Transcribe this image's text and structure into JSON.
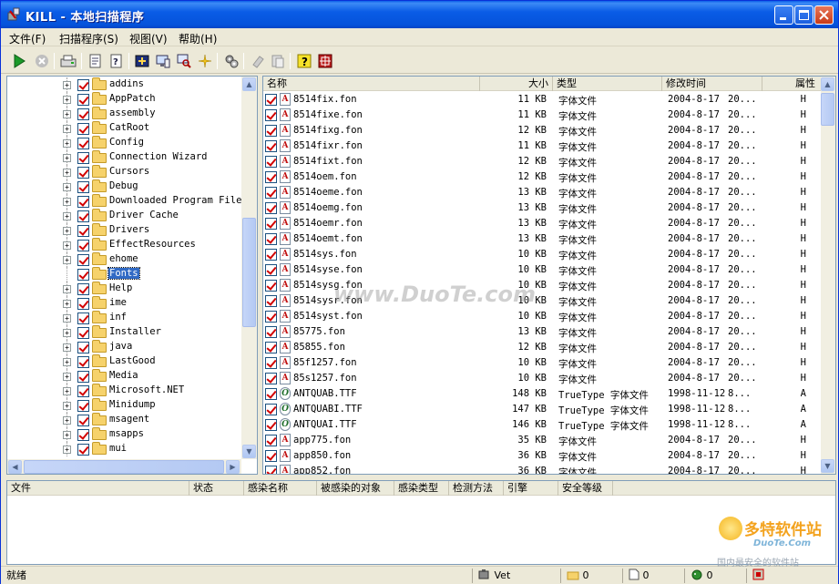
{
  "window": {
    "title": "KILL - 本地扫描程序"
  },
  "menu": [
    "文件(F)",
    "扫描程序(S)",
    "视图(V)",
    "帮助(H)"
  ],
  "tree": {
    "items": [
      {
        "label": "addins",
        "expandable": true
      },
      {
        "label": "AppPatch",
        "expandable": true
      },
      {
        "label": "assembly",
        "expandable": true
      },
      {
        "label": "CatRoot",
        "expandable": true
      },
      {
        "label": "Config",
        "expandable": true
      },
      {
        "label": "Connection Wizard",
        "expandable": true
      },
      {
        "label": "Cursors",
        "expandable": true
      },
      {
        "label": "Debug",
        "expandable": true
      },
      {
        "label": "Downloaded Program Files",
        "expandable": true
      },
      {
        "label": "Driver Cache",
        "expandable": true
      },
      {
        "label": "Drivers",
        "expandable": true
      },
      {
        "label": "EffectResources",
        "expandable": true
      },
      {
        "label": "ehome",
        "expandable": true
      },
      {
        "label": "Fonts",
        "expandable": false,
        "selected": true
      },
      {
        "label": "Help",
        "expandable": true
      },
      {
        "label": "ime",
        "expandable": true
      },
      {
        "label": "inf",
        "expandable": true
      },
      {
        "label": "Installer",
        "expandable": true
      },
      {
        "label": "java",
        "expandable": true
      },
      {
        "label": "LastGood",
        "expandable": true
      },
      {
        "label": "Media",
        "expandable": true
      },
      {
        "label": "Microsoft.NET",
        "expandable": true
      },
      {
        "label": "Minidump",
        "expandable": true
      },
      {
        "label": "msagent",
        "expandable": true
      },
      {
        "label": "msapps",
        "expandable": true
      },
      {
        "label": "mui",
        "expandable": true
      }
    ]
  },
  "list": {
    "columns": [
      "名称",
      "大小",
      "类型",
      "修改时间",
      "属性"
    ],
    "rows": [
      {
        "name": "8514fix.fon",
        "size": "11 KB",
        "type": "字体文件",
        "date": "2004-8-17",
        "time": "20...",
        "attr": "H",
        "icon": "fon"
      },
      {
        "name": "8514fixe.fon",
        "size": "11 KB",
        "type": "字体文件",
        "date": "2004-8-17",
        "time": "20...",
        "attr": "H",
        "icon": "fon"
      },
      {
        "name": "8514fixg.fon",
        "size": "12 KB",
        "type": "字体文件",
        "date": "2004-8-17",
        "time": "20...",
        "attr": "H",
        "icon": "fon"
      },
      {
        "name": "8514fixr.fon",
        "size": "11 KB",
        "type": "字体文件",
        "date": "2004-8-17",
        "time": "20...",
        "attr": "H",
        "icon": "fon"
      },
      {
        "name": "8514fixt.fon",
        "size": "12 KB",
        "type": "字体文件",
        "date": "2004-8-17",
        "time": "20...",
        "attr": "H",
        "icon": "fon"
      },
      {
        "name": "8514oem.fon",
        "size": "12 KB",
        "type": "字体文件",
        "date": "2004-8-17",
        "time": "20...",
        "attr": "H",
        "icon": "fon"
      },
      {
        "name": "8514oeme.fon",
        "size": "13 KB",
        "type": "字体文件",
        "date": "2004-8-17",
        "time": "20...",
        "attr": "H",
        "icon": "fon"
      },
      {
        "name": "8514oemg.fon",
        "size": "13 KB",
        "type": "字体文件",
        "date": "2004-8-17",
        "time": "20...",
        "attr": "H",
        "icon": "fon"
      },
      {
        "name": "8514oemr.fon",
        "size": "13 KB",
        "type": "字体文件",
        "date": "2004-8-17",
        "time": "20...",
        "attr": "H",
        "icon": "fon"
      },
      {
        "name": "8514oemt.fon",
        "size": "13 KB",
        "type": "字体文件",
        "date": "2004-8-17",
        "time": "20...",
        "attr": "H",
        "icon": "fon"
      },
      {
        "name": "8514sys.fon",
        "size": "10 KB",
        "type": "字体文件",
        "date": "2004-8-17",
        "time": "20...",
        "attr": "H",
        "icon": "fon"
      },
      {
        "name": "8514syse.fon",
        "size": "10 KB",
        "type": "字体文件",
        "date": "2004-8-17",
        "time": "20...",
        "attr": "H",
        "icon": "fon"
      },
      {
        "name": "8514sysg.fon",
        "size": "10 KB",
        "type": "字体文件",
        "date": "2004-8-17",
        "time": "20...",
        "attr": "H",
        "icon": "fon"
      },
      {
        "name": "8514sysr.fon",
        "size": "10 KB",
        "type": "字体文件",
        "date": "2004-8-17",
        "time": "20...",
        "attr": "H",
        "icon": "fon"
      },
      {
        "name": "8514syst.fon",
        "size": "10 KB",
        "type": "字体文件",
        "date": "2004-8-17",
        "time": "20...",
        "attr": "H",
        "icon": "fon"
      },
      {
        "name": "85775.fon",
        "size": "13 KB",
        "type": "字体文件",
        "date": "2004-8-17",
        "time": "20...",
        "attr": "H",
        "icon": "fon"
      },
      {
        "name": "85855.fon",
        "size": "12 KB",
        "type": "字体文件",
        "date": "2004-8-17",
        "time": "20...",
        "attr": "H",
        "icon": "fon"
      },
      {
        "name": "85f1257.fon",
        "size": "10 KB",
        "type": "字体文件",
        "date": "2004-8-17",
        "time": "20...",
        "attr": "H",
        "icon": "fon"
      },
      {
        "name": "85s1257.fon",
        "size": "10 KB",
        "type": "字体文件",
        "date": "2004-8-17",
        "time": "20...",
        "attr": "H",
        "icon": "fon"
      },
      {
        "name": "ANTQUAB.TTF",
        "size": "148 KB",
        "type": "TrueType 字体文件",
        "date": "1998-11-12",
        "time": "8...",
        "attr": "A",
        "icon": "ttf"
      },
      {
        "name": "ANTQUABI.TTF",
        "size": "147 KB",
        "type": "TrueType 字体文件",
        "date": "1998-11-12",
        "time": "8...",
        "attr": "A",
        "icon": "ttf"
      },
      {
        "name": "ANTQUAI.TTF",
        "size": "146 KB",
        "type": "TrueType 字体文件",
        "date": "1998-11-12",
        "time": "8...",
        "attr": "A",
        "icon": "ttf"
      },
      {
        "name": "app775.fon",
        "size": "35 KB",
        "type": "字体文件",
        "date": "2004-8-17",
        "time": "20...",
        "attr": "H",
        "icon": "fon"
      },
      {
        "name": "app850.fon",
        "size": "36 KB",
        "type": "字体文件",
        "date": "2004-8-17",
        "time": "20...",
        "attr": "H",
        "icon": "fon"
      },
      {
        "name": "app852.fon",
        "size": "36 KB",
        "type": "字体文件",
        "date": "2004-8-17",
        "time": "20...",
        "attr": "H",
        "icon": "fon"
      }
    ]
  },
  "results": {
    "columns": [
      "文件",
      "状态",
      "感染名称",
      "被感染的对象",
      "感染类型",
      "检测方法",
      "引擎",
      "安全等级"
    ]
  },
  "status": {
    "ready": "就绪",
    "vet": "Vet",
    "count1": "0",
    "count2": "0",
    "count3": "0"
  },
  "watermark": "www.DuoTe.com",
  "logo": {
    "cn": "多特软件站",
    "en": "DuoTe.Com",
    "tagline": "国内最安全的软件站"
  },
  "icons": [
    "play-icon",
    "stop-icon",
    "scan-drive-icon",
    "properties-icon",
    "help-doc-icon",
    "memory-icon",
    "monitor-icon",
    "search-icon",
    "sparkle-icon",
    "settings-icon",
    "eraser-icon",
    "paste-icon",
    "help-icon",
    "exit-icon"
  ],
  "colors": {
    "titlebar": "#0a5ce6",
    "selection": "#316ac5",
    "check": "#d20000",
    "folder": "#f6d26b"
  }
}
